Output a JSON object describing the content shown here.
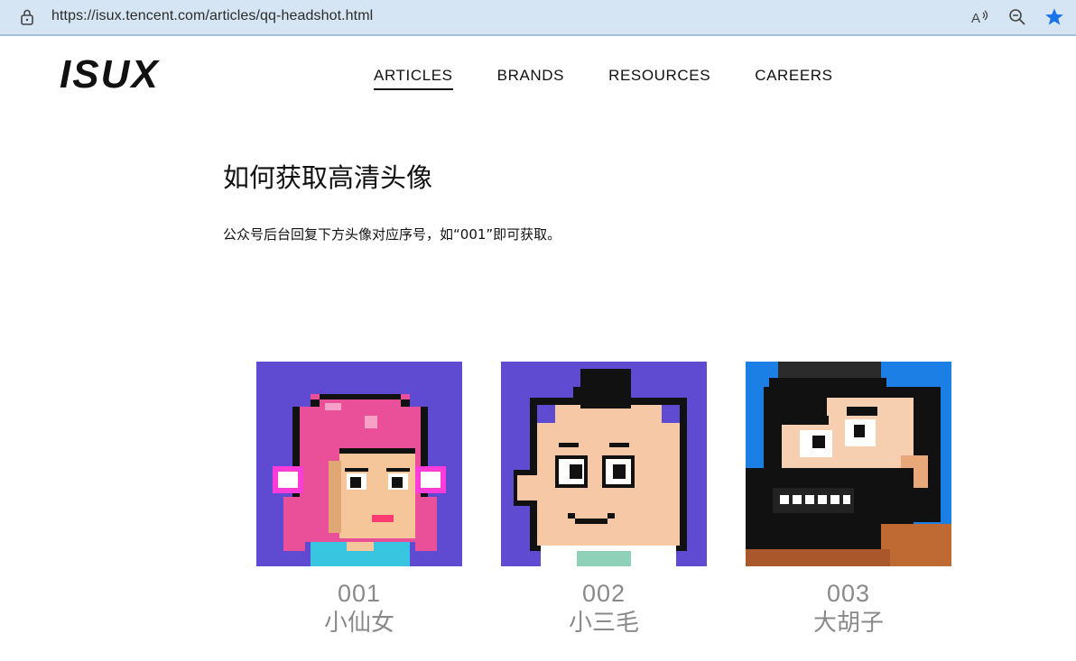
{
  "browser": {
    "url": "https://isux.tencent.com/articles/qq-headshot.html",
    "icons": [
      "lock-icon",
      "read-aloud-icon",
      "zoom-icon",
      "favorite-star-icon"
    ]
  },
  "header": {
    "logo": "ISUX",
    "nav": [
      {
        "label": "ARTICLES",
        "active": true
      },
      {
        "label": "BRANDS",
        "active": false
      },
      {
        "label": "RESOURCES",
        "active": false
      },
      {
        "label": "CAREERS",
        "active": false
      }
    ]
  },
  "article": {
    "title": "如何获取高清头像",
    "intro": "公众号后台回复下方头像对应序号，如“001”即可获取。"
  },
  "avatars": [
    {
      "number": "001",
      "name": "小仙女",
      "bg": "#5f4bd1"
    },
    {
      "number": "002",
      "name": "小三毛",
      "bg": "#5f4bd1"
    },
    {
      "number": "003",
      "name": "大胡子",
      "bg": "#1c7fe6"
    }
  ],
  "colors": {
    "browser_bar": "#d5e5f3",
    "star": "#1a73e8",
    "caption": "#8a8a8a"
  }
}
